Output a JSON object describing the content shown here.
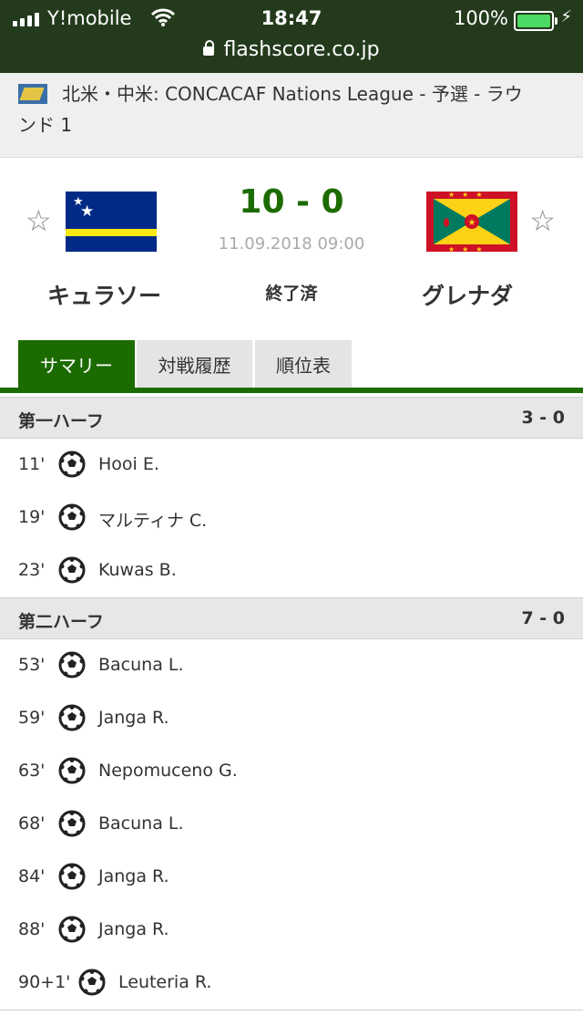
{
  "status_bar": {
    "carrier": "Y!mobile",
    "time": "18:47",
    "battery": "100%",
    "url": "flashscore.co.jp"
  },
  "competition": {
    "line1": "北米・中米: CONCACAF Nations League - 予選 - ラウ",
    "line2": "ンド 1"
  },
  "match": {
    "home_team": "キュラソー",
    "away_team": "グレナダ",
    "score": "10 - 0",
    "datetime": "11.09.2018 09:00",
    "status": "終了済",
    "favorite_icon": "☆"
  },
  "tabs": [
    {
      "label": "サマリー",
      "active": true
    },
    {
      "label": "対戦履歴",
      "active": false
    },
    {
      "label": "順位表",
      "active": false
    }
  ],
  "sections": [
    {
      "title": "第一ハーフ",
      "score": "3 - 0",
      "events": [
        {
          "minute": "11'",
          "player": "Hooi E."
        },
        {
          "minute": "19'",
          "player": "マルティナ C."
        },
        {
          "minute": "23'",
          "player": "Kuwas B."
        }
      ]
    },
    {
      "title": "第二ハーフ",
      "score": "7 - 0",
      "events": [
        {
          "minute": "53'",
          "player": "Bacuna L."
        },
        {
          "minute": "59'",
          "player": "Janga R."
        },
        {
          "minute": "63'",
          "player": "Nepomuceno G."
        },
        {
          "minute": "68'",
          "player": "Bacuna L."
        },
        {
          "minute": "84'",
          "player": "Janga R."
        },
        {
          "minute": "88'",
          "player": "Janga R."
        },
        {
          "minute": "90+1'",
          "player": "Leuteria R."
        }
      ]
    }
  ],
  "colors": {
    "accent": "#1c6b00",
    "status_bar": "#233b1c"
  }
}
